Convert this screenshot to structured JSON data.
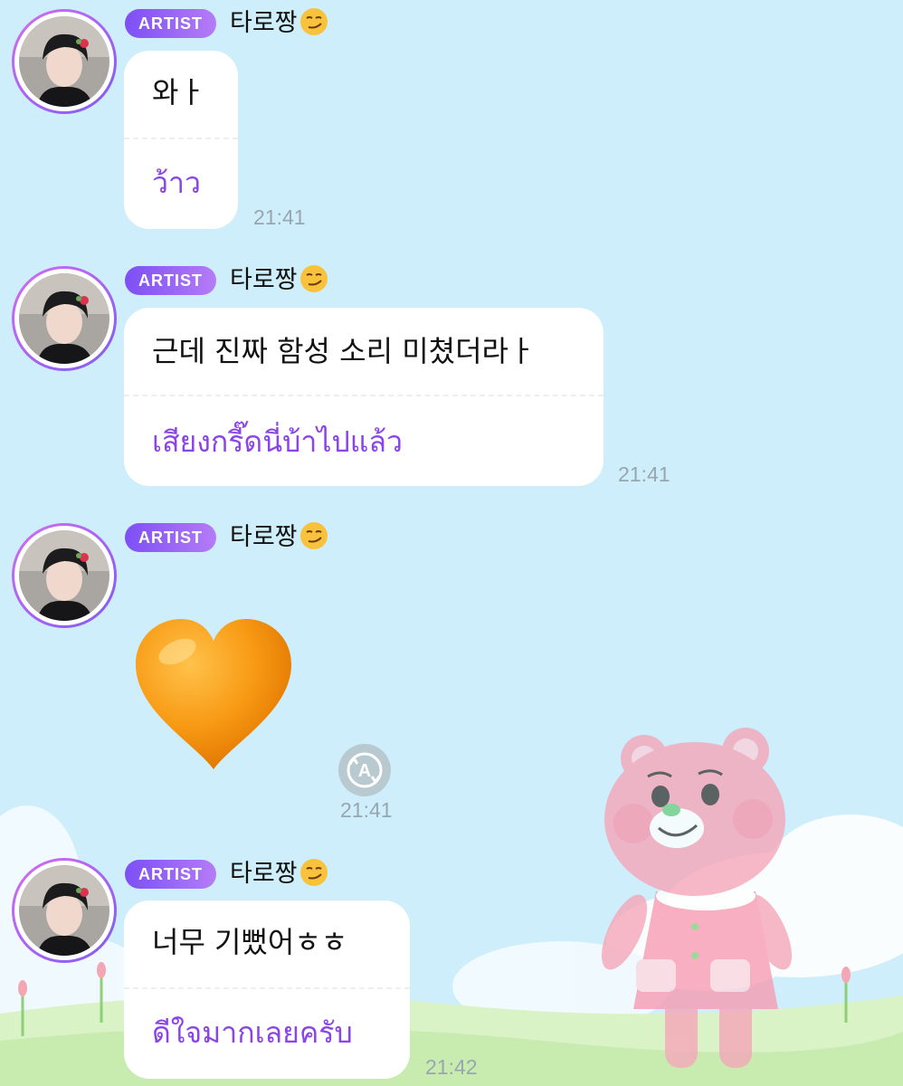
{
  "badge_label": "ARTIST",
  "messages": [
    {
      "nickname": "타로짱",
      "original": "와ㅏ",
      "translation": "ว้าว",
      "time": "21:41"
    },
    {
      "nickname": "타로짱",
      "original": "근데 진짜 함성 소리 미쳤더라ㅏ",
      "translation": "เสียงกรี๊ดนี่บ้าไปแล้ว",
      "time": "21:41"
    },
    {
      "nickname": "타로짱",
      "emoji": "orange-heart",
      "time": "21:41"
    },
    {
      "nickname": "타로짱",
      "original": "너무 기뻤어ㅎㅎ",
      "translation": "ดีใจมากเลยครับ",
      "time": "21:42"
    }
  ],
  "icons": {
    "translate": "translate-icon",
    "nickname_emoji": "smirking-face-emoji"
  },
  "colors": {
    "background": "#cdeefa",
    "badge_gradient_start": "#7d4ff5",
    "badge_gradient_end": "#b57cf7",
    "translation_text": "#8a45e6",
    "timestamp": "#98a6b0",
    "bubble": "#ffffff"
  }
}
